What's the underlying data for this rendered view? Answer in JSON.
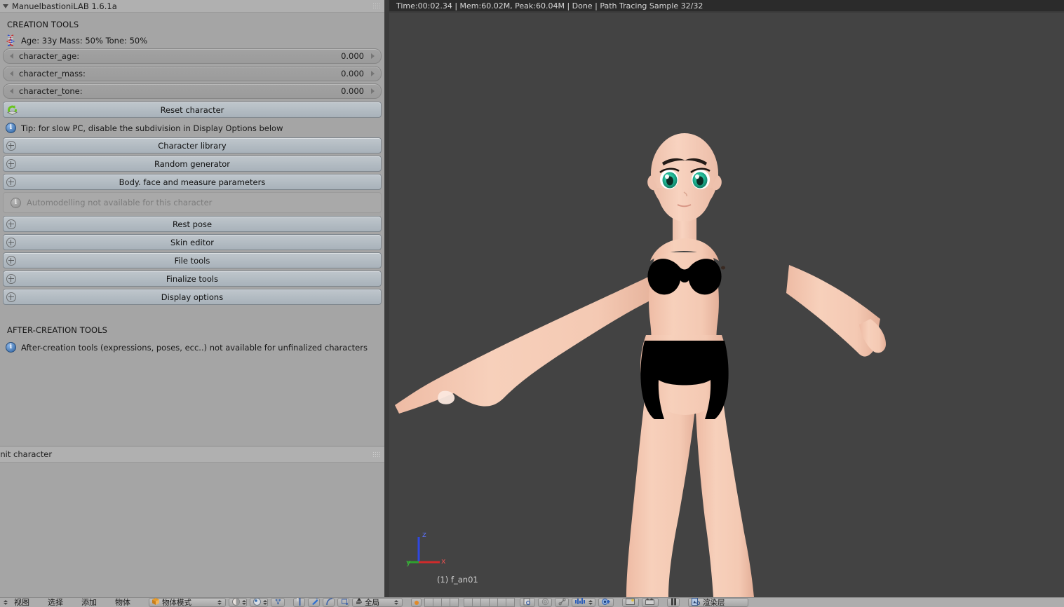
{
  "left_panel": {
    "title": "ManuelbastioniLAB 1.6.1a",
    "grip_icon": "grip-dots-icon",
    "sections": {
      "creation_tools_label": "CREATION TOOLS",
      "after_creation_label": "AFTER-CREATION TOOLS"
    },
    "dna_row": {
      "icon": "dna-icon",
      "text": "Age: 33y  Mass: 50%  Tone: 50%"
    },
    "sliders": [
      {
        "label": "character_age:",
        "value": "0.000",
        "left_arrow": "triangle-left-icon",
        "right_arrow": "triangle-right-icon"
      },
      {
        "label": "character_mass:",
        "value": "0.000",
        "left_arrow": "triangle-left-icon",
        "right_arrow": "triangle-right-icon"
      },
      {
        "label": "character_tone:",
        "value": "0.000",
        "left_arrow": "triangle-left-icon",
        "right_arrow": "triangle-right-icon"
      }
    ],
    "reset_button": {
      "label": "Reset character",
      "icon": "reset-loop-icon"
    },
    "tip": {
      "icon": "info-icon",
      "text": "Tip: for slow PC, disable the subdivision in Display Options below"
    },
    "expanders_top": [
      {
        "label": "Character library",
        "icon": "plus-circle-icon"
      },
      {
        "label": "Random generator",
        "icon": "plus-circle-icon"
      },
      {
        "label": "Body. face and measure parameters",
        "icon": "plus-circle-icon"
      }
    ],
    "automodelling_notice": {
      "icon": "info-icon-disabled",
      "text": "Automodelling not available for this character"
    },
    "expanders_bottom": [
      {
        "label": "Rest pose",
        "icon": "plus-circle-icon"
      },
      {
        "label": "Skin editor",
        "icon": "plus-circle-icon"
      },
      {
        "label": "File tools",
        "icon": "plus-circle-icon"
      },
      {
        "label": "Finalize tools",
        "icon": "plus-circle-icon"
      },
      {
        "label": "Display options",
        "icon": "plus-circle-icon"
      }
    ],
    "after_creation_notice": {
      "icon": "info-icon",
      "text": "After-creation tools (expressions, poses, ecc..) not available for unfinalized characters"
    }
  },
  "init_panel": {
    "title": "Init character",
    "grip_icon": "grip-dots-icon"
  },
  "viewport": {
    "render_status": "Time:00:02.34 | Mem:60.02M, Peak:60.04M | Done | Path Tracing Sample 32/32",
    "object_name": "(1) f_an01",
    "axis_gizmo": {
      "name": "axis-gizmo",
      "z_label": "z",
      "x_label": "x",
      "y_label": "y",
      "z_color": "#2f47e0",
      "x_color": "#d02b2b",
      "y_color": "#2fa02f"
    },
    "background_color": "#434343",
    "character": {
      "skin_color": "#f6cdb8",
      "skin_shade": "#e9b9a3",
      "clothing_color": "#000000",
      "eye_color": "#22b894",
      "eye_dark": "#0c3a30",
      "brow_color": "#1a1412",
      "lip_color": "#e8a394"
    }
  },
  "bottom_bar": {
    "menus": [
      "视图",
      "选择",
      "添加",
      "物体"
    ],
    "mode_selector": {
      "label": "物体模式",
      "icon": "cube-icon"
    },
    "render_layer": {
      "label": "渲染层",
      "icon": "render-layer-icon"
    },
    "global_selector": {
      "label": "全局",
      "icon": "global-icon"
    },
    "icon_buttons": [
      "shading-sphere-icon",
      "shading-solid-icon",
      "wireframe-icon",
      "pivot-icon",
      "snap-magnet-icon",
      "curve-icon",
      "proportional-edit-icon",
      "grid-icon",
      "camera-icon",
      "scene-icon",
      "clip-icon",
      "pause-icon"
    ]
  }
}
